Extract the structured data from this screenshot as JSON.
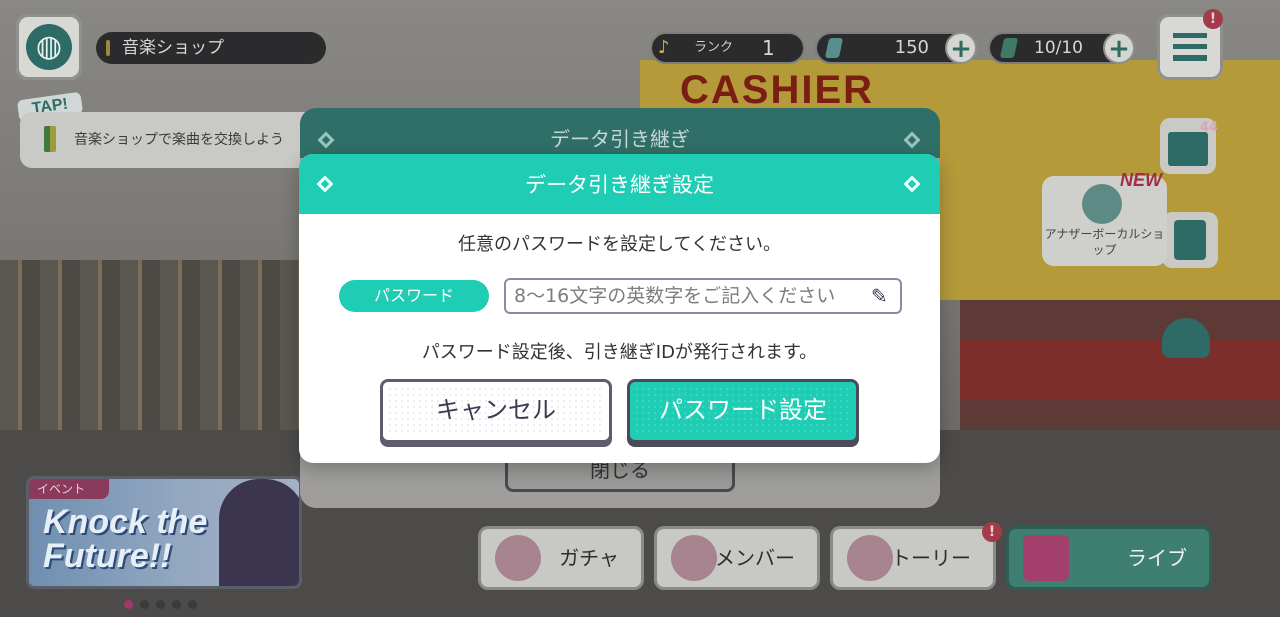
{
  "hud": {
    "location": "音楽ショップ",
    "rank_label": "ランク",
    "rank_value": "1",
    "gems": "150",
    "tickets": "10/10",
    "plus": "+",
    "menu_alert": "!",
    "gift_count": "44"
  },
  "hint": {
    "tap": "TAP!",
    "text": "音楽ショップで楽曲を交換しよう"
  },
  "scene": {
    "cashier_sign": "CASHIER",
    "another_shop": "アナザーボーカルショップ",
    "new_tag": "NEW"
  },
  "event": {
    "tag": "イベント",
    "logo": "Knock the Future!!"
  },
  "nav": {
    "gacha": "ガチャ",
    "member": "メンバー",
    "story": "ストーリー",
    "live": "ライブ",
    "story_alert": "!"
  },
  "under_dialog": {
    "title": "データ引き継ぎ",
    "close": "閉じる"
  },
  "dialog": {
    "title": "データ引き継ぎ設定",
    "instruction": "任意のパスワードを設定してください。",
    "password_label": "パスワード",
    "password_placeholder": "8～16文字の英数字をご記入ください",
    "password_value": "",
    "note": "パスワード設定後、引き継ぎIDが発行されます。",
    "cancel": "キャンセル",
    "confirm": "パスワード設定"
  },
  "colors": {
    "accent": "#1ecdb4",
    "button_border": "#4b4b5a",
    "overlay_dim": "#6b6a68"
  },
  "icons": [
    "globe-icon",
    "location-pin-icon",
    "rank-note-icon",
    "gem-icon",
    "ticket-icon",
    "plus-icon",
    "menu-icon",
    "gift-icon",
    "mission-icon",
    "friends-icon",
    "disk-icon",
    "pencil-icon",
    "gacha-icon",
    "member-icon",
    "story-icon",
    "live-icon"
  ]
}
